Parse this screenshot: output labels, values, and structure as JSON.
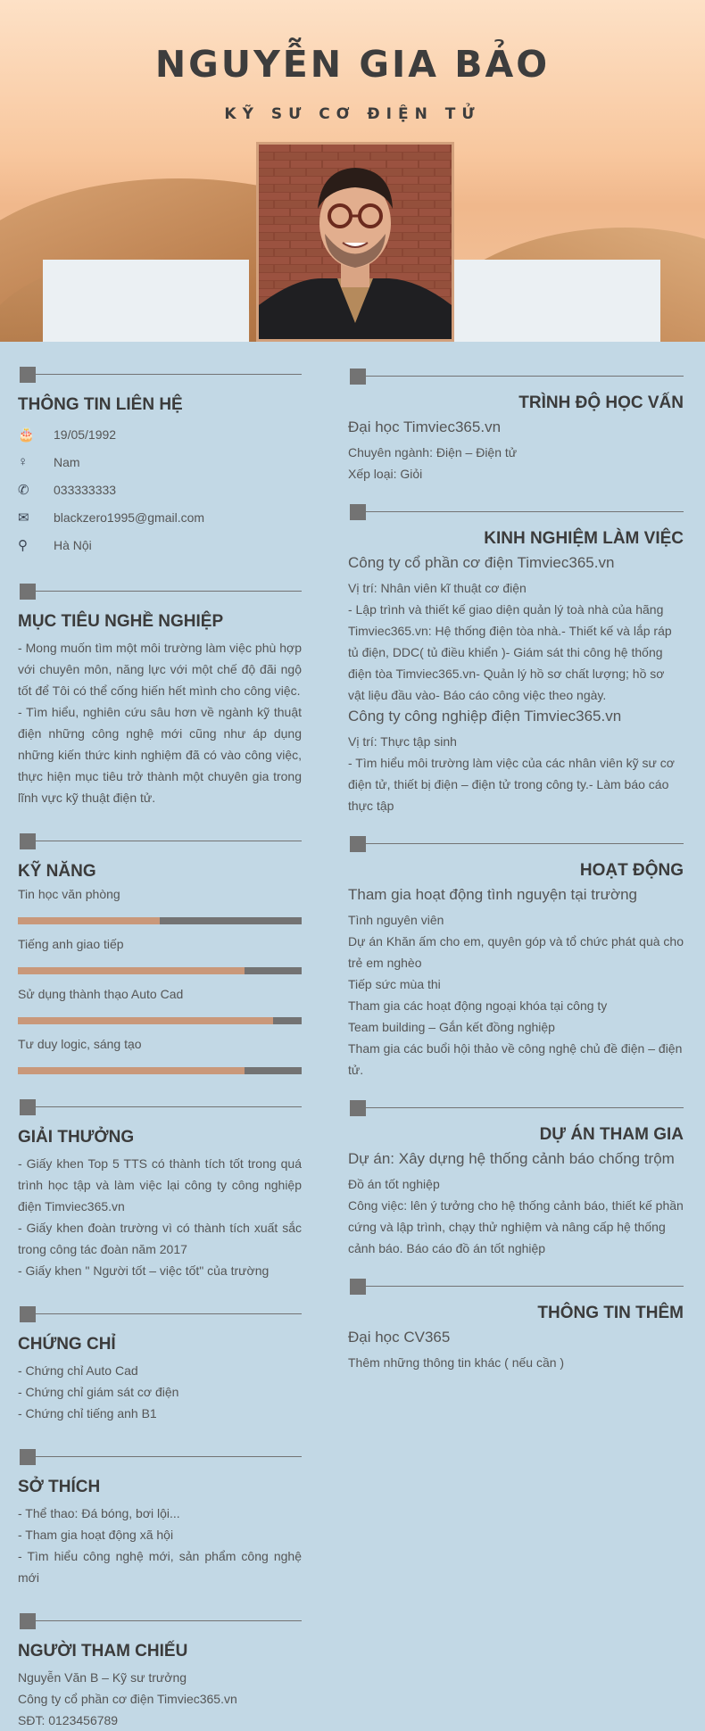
{
  "header": {
    "name": "NGUYỄN GIA BẢO",
    "title": "KỸ SƯ CƠ ĐIỆN TỬ"
  },
  "contact": {
    "title": "THÔNG TIN LIÊN HỆ",
    "birthday": "19/05/1992",
    "gender": "Nam",
    "phone": "033333333",
    "email": "blackzero1995@gmail.com",
    "address": "Hà Nội"
  },
  "objective": {
    "title": "MỤC TIÊU NGHỀ NGHIỆP",
    "p1": "- Mong muốn tìm một môi trường làm việc phù hợp với chuyên môn, năng lực với một chế độ đãi ngộ tốt để Tôi có thể cống hiến hết mình cho công việc.",
    "p2": "- Tìm hiểu, nghiên cứu sâu hơn về ngành kỹ thuật điện những công nghệ mới cũng như áp dụng những kiến thức kinh nghiệm đã có vào công việc, thực hiện mục tiêu trở thành một chuyên gia trong lĩnh vực kỹ thuật điện tử."
  },
  "skills": {
    "title": "KỸ NĂNG",
    "items": [
      {
        "label": "Tin học văn phòng",
        "level": 0.5
      },
      {
        "label": "Tiếng anh giao tiếp",
        "level": 0.8
      },
      {
        "label": "Sử dụng thành thạo Auto Cad",
        "level": 0.9
      },
      {
        "label": "Tư duy logic, sáng tạo",
        "level": 0.8
      }
    ]
  },
  "awards": {
    "title": "GIẢI THƯỞNG",
    "p1": "- Giấy khen Top 5 TTS có thành tích tốt trong quá trình học tập và làm việc lại công ty công nghiệp điện Timviec365.vn",
    "p2": "- Giấy khen đoàn trường vì có thành tích xuất sắc trong công tác đoàn năm 2017",
    "p3": "- Giấy khen \" Người tốt – việc tốt\" của trường"
  },
  "certificates": {
    "title": "CHỨNG CHỈ",
    "items": [
      "- Chứng chỉ Auto Cad",
      "- Chứng chỉ giám sát cơ điện",
      "- Chứng chỉ tiếng anh B1"
    ]
  },
  "hobbies": {
    "title": "SỞ THÍCH",
    "items": [
      "- Thể thao: Đá bóng, bơi lội...",
      "- Tham gia hoạt động xã hội",
      "- Tìm hiểu công nghệ mới, sản phẩm công nghệ mới"
    ]
  },
  "references": {
    "title": "NGƯỜI THAM CHIẾU",
    "items": [
      "Nguyễn Văn B – Kỹ sư trưởng",
      "Công ty  cổ phần cơ điện Timviec365.vn",
      "SĐT: 0123456789"
    ]
  },
  "education": {
    "title": "TRÌNH ĐỘ HỌC VẤN",
    "school": "Đại học Timviec365.vn",
    "major": "Chuyên ngành: Điện – Điện tử",
    "grade": "Xếp loại: Giỏi"
  },
  "experience": {
    "title": "KINH NGHIỆM LÀM VIỆC",
    "jobs": [
      {
        "company": "Công ty cổ phần cơ điện Timviec365.vn",
        "position": "Vị trí: Nhân viên kĩ thuật cơ điện",
        "desc": "- Lập trình và thiết kế giao diện quản lý toà nhà của hãng Timviec365.vn: Hệ thống điện tòa nhà.- Thiết kế và lắp ráp tủ điện, DDC( tủ điều khiển )- Giám sát thi công hệ thống điện tòa Timviec365.vn- Quản lý hồ sơ chất lượng; hồ sơ vật liệu đầu vào- Báo cáo công việc theo ngày."
      },
      {
        "company": "Công ty  công nghiệp điện Timviec365.vn",
        "position": "Vị trí: Thực tập sinh",
        "desc": "- Tìm hiểu môi trường làm việc của các nhân viên kỹ sư cơ điện tử, thiết bị điện – điện tử trong công ty.- Làm báo cáo thực tập"
      }
    ]
  },
  "activities": {
    "title": "HOẠT ĐỘNG",
    "headline": "Tham gia hoạt động tình nguyện tại trường",
    "items": [
      "Tình nguyên viên",
      "Dự án Khăn ấm cho em, quyên góp và tổ chức phát quà cho trẻ em nghèo",
      "Tiếp sức mùa thi",
      "Tham gia các hoạt động ngoại khóa tại công ty",
      "Team building – Gắn kết đồng nghiệp",
      "Tham gia các buổi hội thảo về công nghệ chủ đề điện – điện tử."
    ]
  },
  "projects": {
    "title": "DỰ ÁN THAM GIA",
    "headline": "Dự án: Xây dựng hệ thống cảnh báo chống trộm",
    "type": "Đồ án tốt nghiệp",
    "desc": "Công việc: lên ý tưởng cho hệ thống cảnh báo, thiết kế phần cứng và lập trình, chạy thử nghiệm và nâng cấp hệ thống cảnh báo. Báo cáo đồ án tốt nghiệp"
  },
  "extra": {
    "title": "THÔNG TIN THÊM",
    "headline": "Đại học CV365",
    "desc": "Thêm những thông tin khác ( nếu cần )"
  }
}
